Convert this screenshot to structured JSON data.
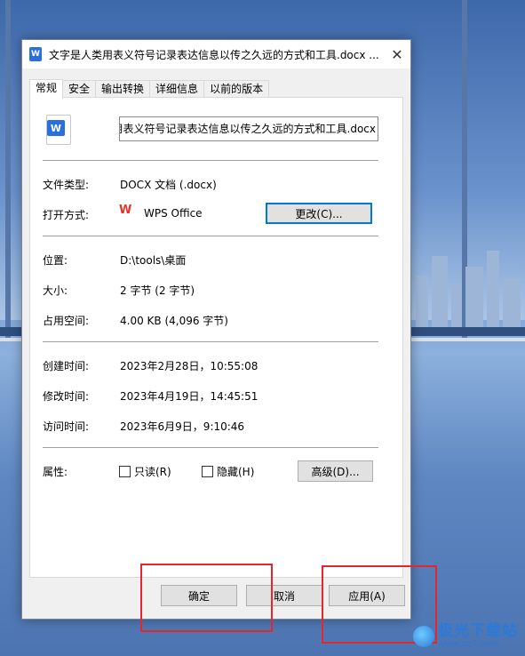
{
  "window": {
    "title": "文字是人类用表义符号记录表达信息以传之久远的方式和工具.docx ...",
    "close_glyph": "✕",
    "title_icon": "W"
  },
  "tabs": [
    {
      "label": "常规",
      "active": true
    },
    {
      "label": "安全",
      "active": false
    },
    {
      "label": "输出转换",
      "active": false
    },
    {
      "label": "详细信息",
      "active": false
    },
    {
      "label": "以前的版本",
      "active": false
    }
  ],
  "file": {
    "icon_letter": "W",
    "name_value": "文字是人类用表义符号记录表达信息以传之久远的方式和工具.docx",
    "type_label": "文件类型:",
    "type_value": "DOCX 文档 (.docx)",
    "open_with_label": "打开方式:",
    "open_with_value": "WPS Office",
    "open_with_icon": "W",
    "change_button": "更改(C)..."
  },
  "location": {
    "location_label": "位置:",
    "location_value": "D:\\tools\\桌面",
    "size_label": "大小:",
    "size_value": "2 字节 (2 字节)",
    "disk_label": "占用空间:",
    "disk_value": "4.00 KB (4,096 字节)"
  },
  "times": {
    "created_label": "创建时间:",
    "created_value": "2023年2月28日，10:55:08",
    "modified_label": "修改时间:",
    "modified_value": "2023年4月19日，14:45:51",
    "accessed_label": "访问时间:",
    "accessed_value": "2023年6月9日，9:10:46"
  },
  "attributes": {
    "label": "属性:",
    "readonly_label": "只读(R)",
    "hidden_label": "隐藏(H)",
    "advanced_button": "高级(D)...",
    "readonly_checked": false,
    "hidden_checked": false
  },
  "footer": {
    "ok": "确定",
    "cancel": "取消",
    "apply": "应用(A)"
  },
  "watermark": {
    "title": "极光下载站",
    "url": "www.xz7.com"
  },
  "colors": {
    "highlight_box": "#e3262f",
    "focus_border": "#0078d7",
    "word_blue": "#2a6fde",
    "wps_red": "#e5332a"
  }
}
